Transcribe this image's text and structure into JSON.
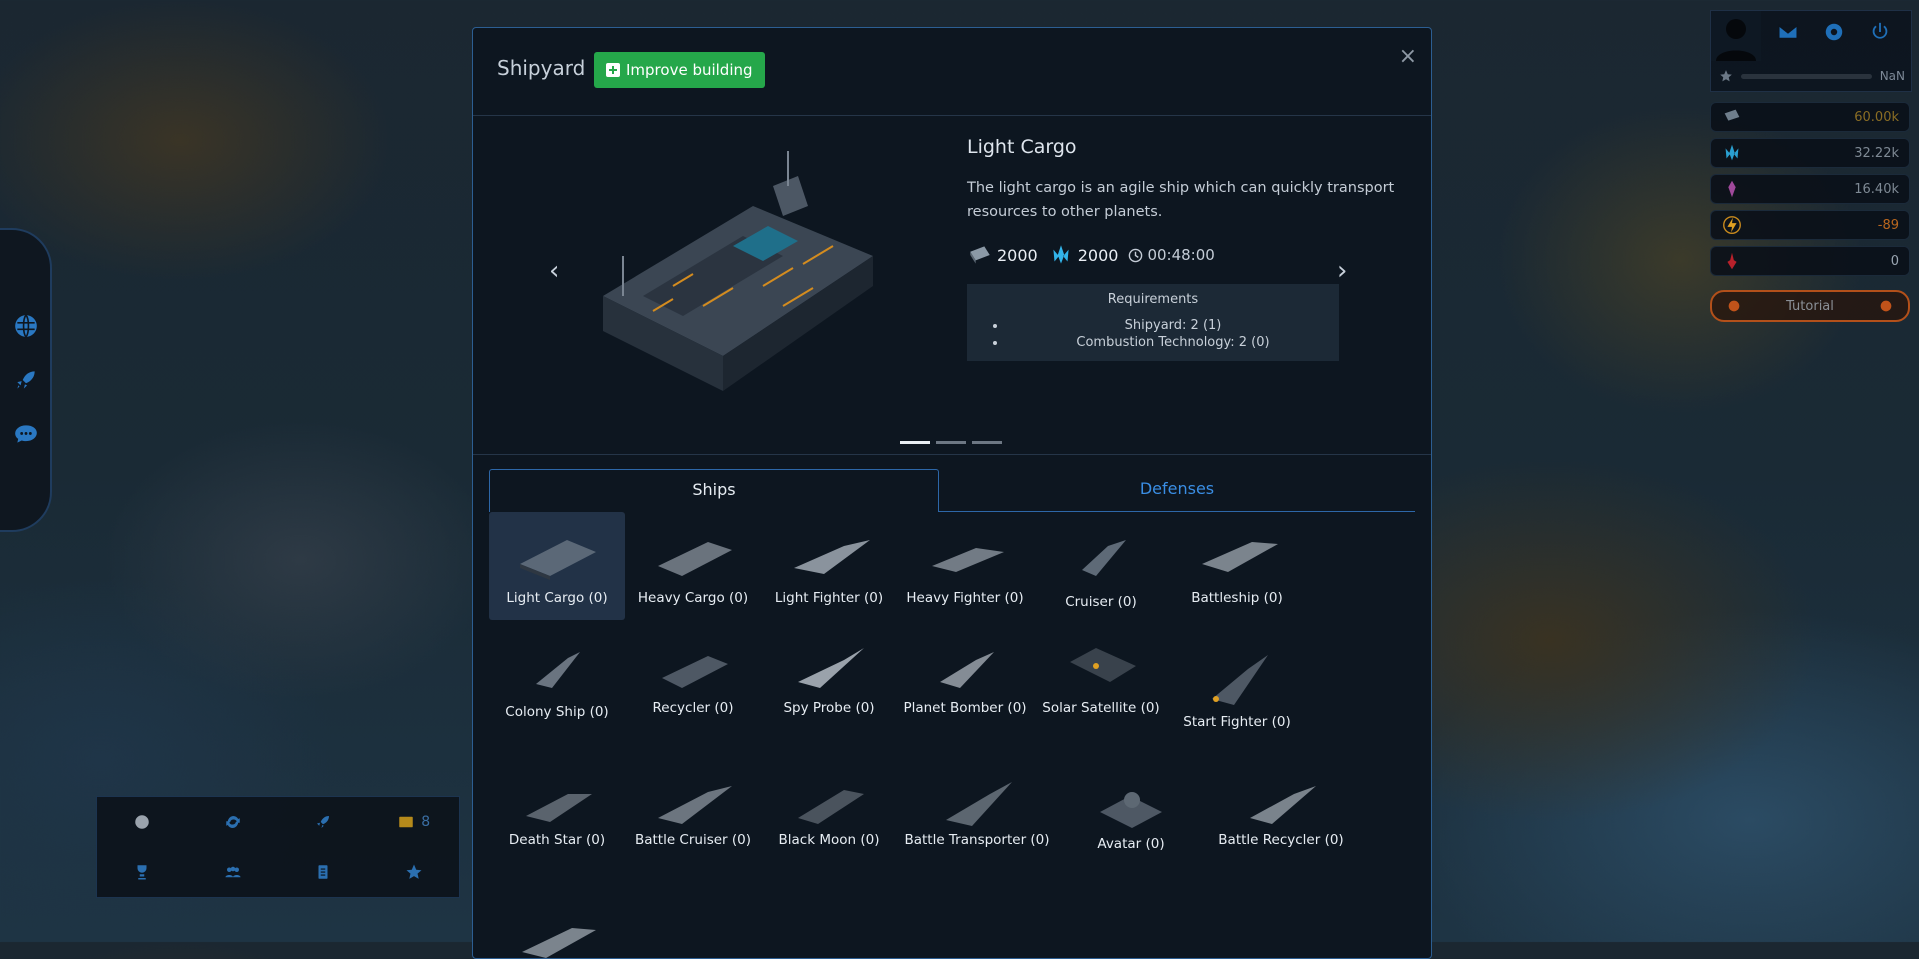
{
  "left_rail": {
    "items": [
      "globe-icon",
      "rocket-icon",
      "chat-icon"
    ]
  },
  "quick_menu": {
    "messages_count": "8"
  },
  "profile": {
    "level": "NaN"
  },
  "resources": {
    "metal": "60.00k",
    "crystal": "32.22k",
    "deuterium": "16.40k",
    "energy": "-89",
    "dark_matter": "0"
  },
  "tutorial": {
    "label": "Tutorial"
  },
  "modal": {
    "title": "Shipyard",
    "improve_label": "Improve building",
    "close": "×",
    "selected": {
      "name": "Light Cargo",
      "description": "The light cargo is an agile ship which can quickly transport resources to other planets.",
      "cost_metal": "2000",
      "cost_crystal": "2000",
      "time": "00:48:00",
      "requirements_title": "Requirements",
      "requirements": [
        "Shipyard: 2 (1)",
        "Combustion Technology: 2 (0)"
      ]
    },
    "prev": "‹",
    "next": "›",
    "tabs": [
      "Ships",
      "Defenses"
    ],
    "ships": [
      "Light Cargo (0)",
      "Heavy Cargo (0)",
      "Light Fighter (0)",
      "Heavy Fighter (0)",
      "Cruiser (0)",
      "Battleship (0)",
      "Colony Ship (0)",
      "Recycler (0)",
      "Spy Probe (0)",
      "Planet Bomber (0)",
      "Solar Satellite (0)",
      "Start Fighter (0)",
      "Death Star (0)",
      "Battle Cruiser (0)",
      "Black Moon (0)",
      "Battle Transporter (0)",
      "Avatar (0)",
      "Battle Recycler (0)"
    ]
  },
  "colors": {
    "accent": "#2c5e92",
    "improve": "#25a74a",
    "tab_active_text": "#e7edf3",
    "tab_inactive_text": "#3a8ee4"
  }
}
